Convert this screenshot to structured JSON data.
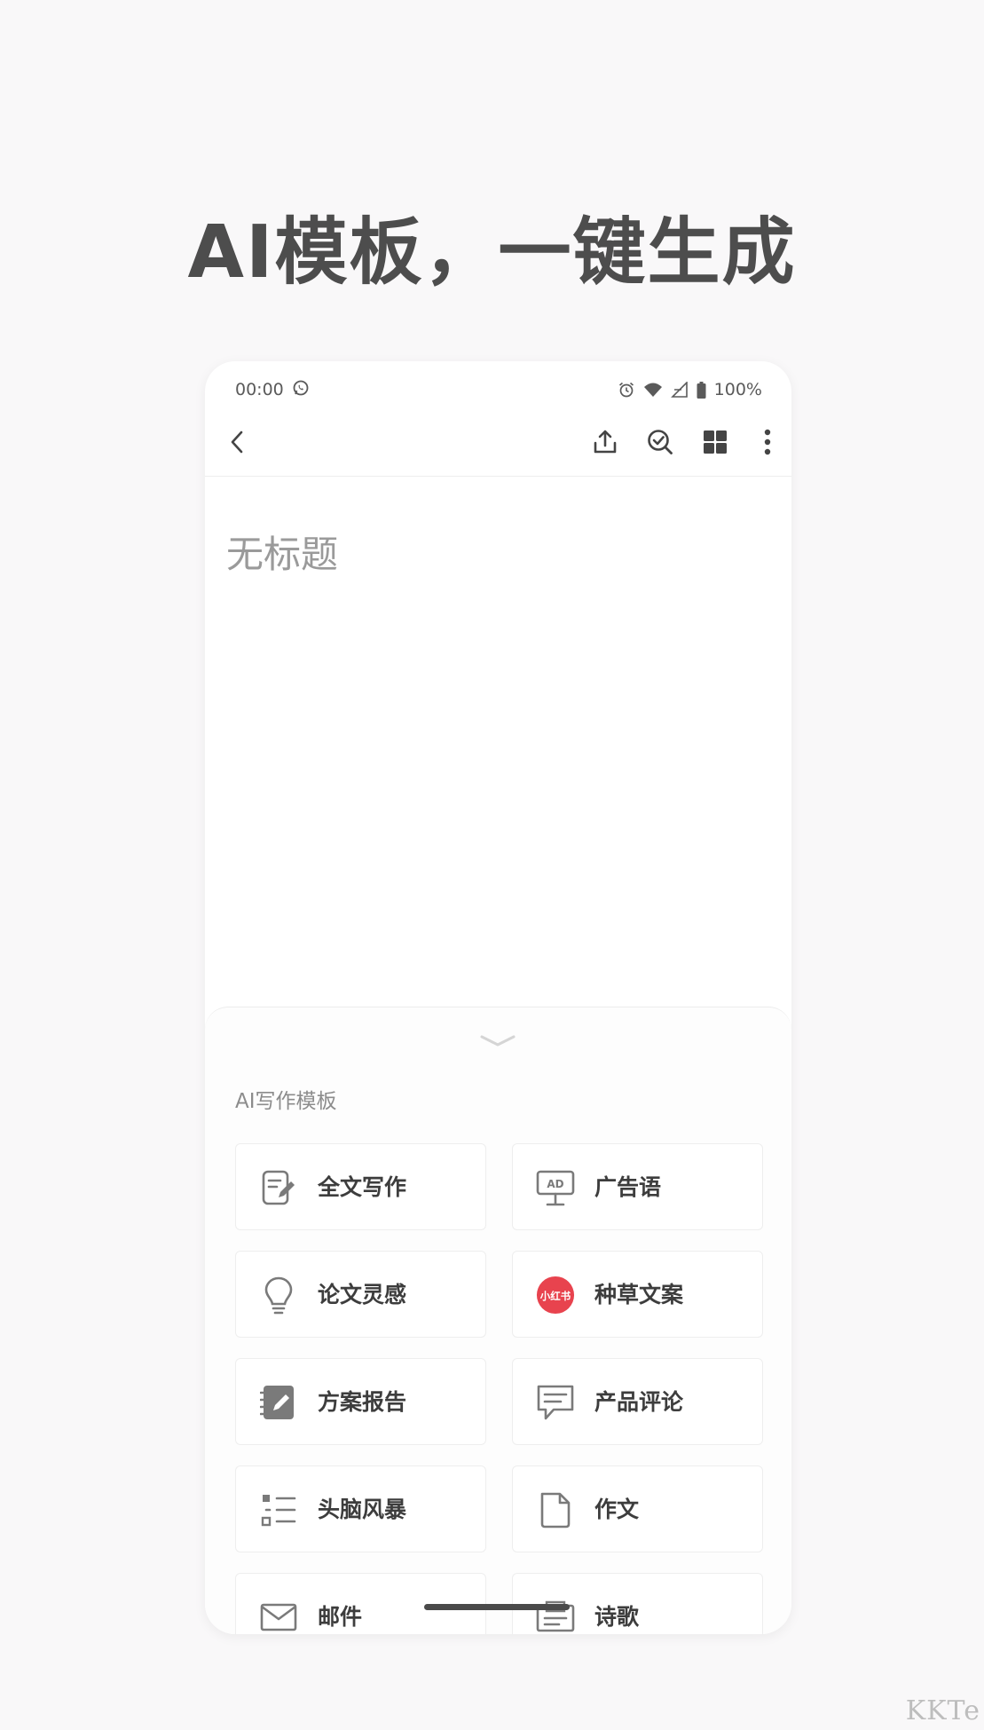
{
  "headline": "AI模板，一键生成",
  "status_bar": {
    "time": "00:00",
    "battery": "100%",
    "icons": [
      "whatsapp-icon",
      "alarm-icon",
      "wifi-icon",
      "signal-icon",
      "battery-icon"
    ]
  },
  "toolbar": {
    "icons": [
      "back-arrow-icon",
      "share-icon",
      "check-search-icon",
      "grid-icon",
      "more-vert-icon"
    ]
  },
  "note": {
    "title_placeholder": "无标题"
  },
  "sheet": {
    "title": "AI写作模板",
    "templates": [
      {
        "label": "全文写作",
        "icon": "pen-document-icon"
      },
      {
        "label": "广告语",
        "icon": "ad-billboard-icon"
      },
      {
        "label": "论文灵感",
        "icon": "lightbulb-icon"
      },
      {
        "label": "种草文案",
        "icon": "xiaohongshu-logo-icon",
        "logo_text": "小红书",
        "logo_color": "#e8434e"
      },
      {
        "label": "方案报告",
        "icon": "notebook-pen-icon"
      },
      {
        "label": "产品评论",
        "icon": "comment-icon"
      },
      {
        "label": "头脑风暴",
        "icon": "list-icon"
      },
      {
        "label": "作文",
        "icon": "page-icon"
      },
      {
        "label": "邮件",
        "icon": "mail-icon"
      },
      {
        "label": "诗歌",
        "icon": "poem-icon"
      }
    ]
  },
  "watermark": "KKTe",
  "colors": {
    "page_bg": "#f9f8f9",
    "headline": "#4d4d4d",
    "accent_red": "#e8434e",
    "icon_gray": "#7a7a7a"
  }
}
